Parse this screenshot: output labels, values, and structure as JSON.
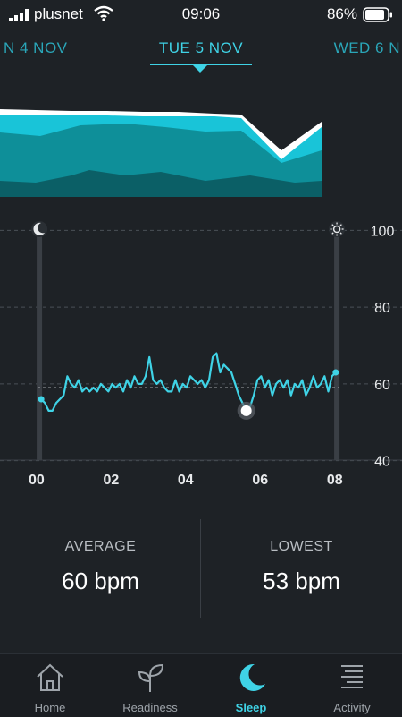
{
  "status": {
    "carrier": "plusnet",
    "time": "09:06",
    "battery_pct": "86%"
  },
  "dates": {
    "prev": "N 4 NOV",
    "current": "TUE 5 NOV",
    "next": "WED 6 N"
  },
  "chart_data": {
    "type": "line",
    "title": "",
    "xlabel": "",
    "ylabel": "",
    "x_tick_labels": [
      "00",
      "02",
      "04",
      "06",
      "08"
    ],
    "y_tick_labels": [
      "40",
      "60",
      "80",
      "100"
    ],
    "ylim": [
      35,
      105
    ],
    "xlim": [
      0,
      8.1
    ],
    "bedtime": "00:03",
    "wake_time": "08:02",
    "average_line": 59,
    "lowest_marker": {
      "x": 5.6,
      "y": 53
    },
    "series": [
      {
        "values": [
          [
            0.1,
            56
          ],
          [
            0.2,
            55
          ],
          [
            0.3,
            53
          ],
          [
            0.4,
            53
          ],
          [
            0.5,
            55
          ],
          [
            0.6,
            56
          ],
          [
            0.7,
            57
          ],
          [
            0.8,
            62
          ],
          [
            0.9,
            60
          ],
          [
            1.0,
            59
          ],
          [
            1.1,
            61
          ],
          [
            1.2,
            58
          ],
          [
            1.3,
            59
          ],
          [
            1.4,
            58
          ],
          [
            1.5,
            59
          ],
          [
            1.6,
            58
          ],
          [
            1.7,
            60
          ],
          [
            1.8,
            59
          ],
          [
            1.9,
            58
          ],
          [
            2.0,
            60
          ],
          [
            2.1,
            59
          ],
          [
            2.2,
            60
          ],
          [
            2.3,
            58
          ],
          [
            2.4,
            61
          ],
          [
            2.5,
            59
          ],
          [
            2.6,
            62
          ],
          [
            2.7,
            60
          ],
          [
            2.8,
            60
          ],
          [
            2.9,
            62
          ],
          [
            3.0,
            67
          ],
          [
            3.1,
            61
          ],
          [
            3.2,
            60
          ],
          [
            3.3,
            61
          ],
          [
            3.4,
            59
          ],
          [
            3.5,
            58
          ],
          [
            3.6,
            58
          ],
          [
            3.7,
            61
          ],
          [
            3.8,
            58
          ],
          [
            3.9,
            60
          ],
          [
            4.0,
            59
          ],
          [
            4.1,
            62
          ],
          [
            4.2,
            61
          ],
          [
            4.3,
            60
          ],
          [
            4.4,
            61
          ],
          [
            4.5,
            59
          ],
          [
            4.6,
            61
          ],
          [
            4.7,
            67
          ],
          [
            4.8,
            68
          ],
          [
            4.9,
            63
          ],
          [
            5.0,
            65
          ],
          [
            5.1,
            64
          ],
          [
            5.2,
            63
          ],
          [
            5.3,
            60
          ],
          [
            5.4,
            57
          ],
          [
            5.5,
            55
          ],
          [
            5.6,
            53
          ],
          [
            5.7,
            54
          ],
          [
            5.8,
            57
          ],
          [
            5.9,
            61
          ],
          [
            6.0,
            62
          ],
          [
            6.1,
            59
          ],
          [
            6.2,
            61
          ],
          [
            6.3,
            57
          ],
          [
            6.4,
            60
          ],
          [
            6.5,
            61
          ],
          [
            6.6,
            59
          ],
          [
            6.7,
            61
          ],
          [
            6.8,
            57
          ],
          [
            6.9,
            60
          ],
          [
            7.0,
            59
          ],
          [
            7.1,
            61
          ],
          [
            7.2,
            57
          ],
          [
            7.3,
            59
          ],
          [
            7.4,
            62
          ],
          [
            7.5,
            59
          ],
          [
            7.6,
            60
          ],
          [
            7.7,
            62
          ],
          [
            7.8,
            58
          ],
          [
            7.9,
            62
          ],
          [
            8.0,
            63
          ]
        ]
      }
    ]
  },
  "stats": {
    "average": {
      "label": "AVERAGE",
      "value": "60 bpm"
    },
    "lowest": {
      "label": "LOWEST",
      "value": "53 bpm"
    }
  },
  "nav": {
    "items": [
      {
        "label": "Home",
        "icon": "home-icon",
        "active": false
      },
      {
        "label": "Readiness",
        "icon": "sprout-icon",
        "active": false
      },
      {
        "label": "Sleep",
        "icon": "moon-icon",
        "active": true
      },
      {
        "label": "Activity",
        "icon": "activity-list-icon",
        "active": false
      }
    ]
  },
  "colors": {
    "accent": "#3fd3e6",
    "stage_light": "#19c4d8",
    "stage_deep": "#0e8f99",
    "background": "#1e2226"
  }
}
